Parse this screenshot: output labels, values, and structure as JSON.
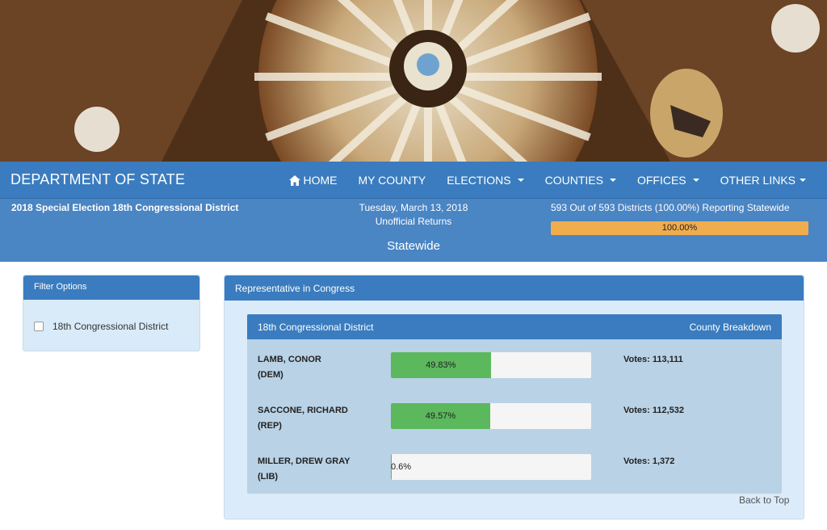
{
  "navbar": {
    "brand": "DEPARTMENT OF STATE",
    "items": [
      {
        "label": "HOME",
        "icon": "home-icon",
        "dropdown": false
      },
      {
        "label": "MY COUNTY",
        "dropdown": false
      },
      {
        "label": "ELECTIONS",
        "dropdown": true
      },
      {
        "label": "COUNTIES",
        "dropdown": true
      },
      {
        "label": "OFFICES",
        "dropdown": true
      },
      {
        "label": "OTHER LINKS",
        "dropdown": true
      }
    ]
  },
  "election": {
    "title": "2018 Special Election 18th Congressional District",
    "date": "Tuesday, March 13, 2018",
    "returns": "Unofficial Returns",
    "scope": "Statewide",
    "reporting": "593 Out of 593 Districts (100.00%) Reporting Statewide",
    "reporting_percent_label": "100.00%",
    "reporting_fraction": 1.0
  },
  "filter": {
    "title": "Filter Options",
    "options": [
      {
        "label": "18th Congressional District",
        "checked": false
      }
    ]
  },
  "race": {
    "title": "Representative in Congress",
    "district_title": "18th Congressional District",
    "breakdown_link": "County Breakdown",
    "candidates": [
      {
        "name": "LAMB, CONOR",
        "party": "(DEM)",
        "percent_label": "49.83%",
        "percent": 49.83,
        "votes": "Votes: 113,111"
      },
      {
        "name": "SACCONE, RICHARD",
        "party": "(REP)",
        "percent_label": "49.57%",
        "percent": 49.57,
        "votes": "Votes: 112,532"
      },
      {
        "name": "MILLER, DREW GRAY",
        "party": "(LIB)",
        "percent_label": "0.6%",
        "percent": 0.6,
        "votes": "Votes: 1,372"
      }
    ]
  },
  "back_to_top": "Back to Top",
  "colors": {
    "primary": "#3a7cbf",
    "progress": "#f0ad4e",
    "success": "#5cb85c"
  }
}
